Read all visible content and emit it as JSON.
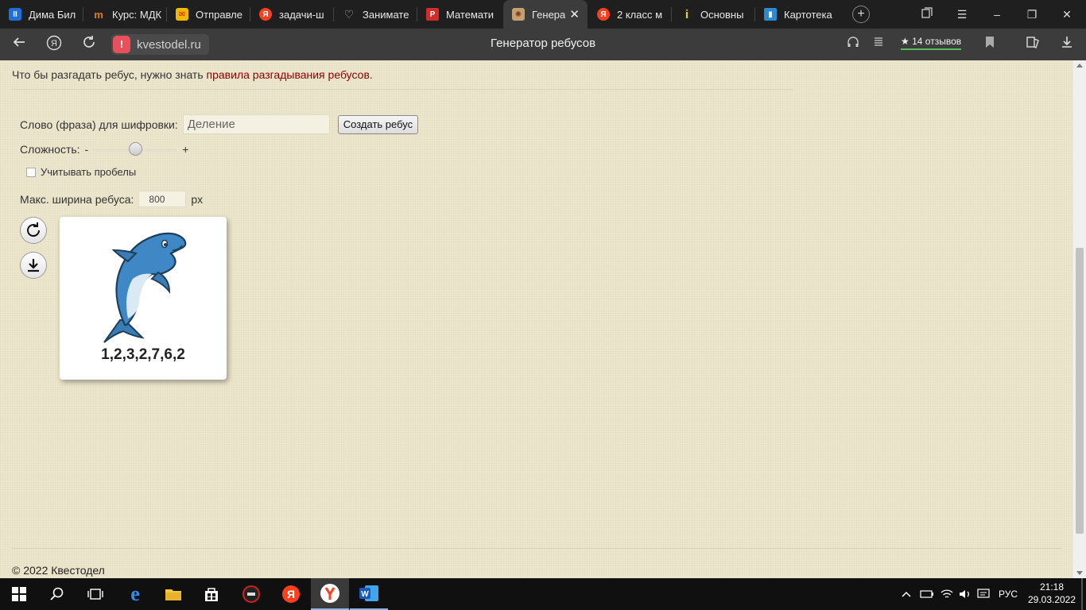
{
  "browser": {
    "tabs": [
      {
        "title": "Дима Бил",
        "icon": "app-blue-icon",
        "color": "#1e6fd9",
        "glyph": "II"
      },
      {
        "title": "Курс: МДК",
        "icon": "m-logo-icon",
        "color": "#e07a1f",
        "glyph": "m"
      },
      {
        "title": "Отправле",
        "icon": "mail-icon",
        "color": "#f5b800",
        "glyph": "✉"
      },
      {
        "title": "задачи-ш",
        "icon": "yandex-icon",
        "color": "#fc3f1d",
        "glyph": "Я"
      },
      {
        "title": "Занимате",
        "icon": "heart-icon",
        "color": "#555555",
        "glyph": "♡"
      },
      {
        "title": "Математи",
        "icon": "p-logo-icon",
        "color": "#d22b2b",
        "glyph": "P"
      },
      {
        "title": "Генера",
        "icon": "rebus-site-icon",
        "color": "#c8a070",
        "glyph": "✺",
        "active": true
      },
      {
        "title": "2 класс м",
        "icon": "yandex-icon",
        "color": "#fc3f1d",
        "glyph": "Я"
      },
      {
        "title": "Основны",
        "icon": "info-icon",
        "color": "#f3d11f",
        "glyph": "i"
      },
      {
        "title": "Картотека",
        "icon": "book-icon",
        "color": "#2a8ad2",
        "glyph": "▮"
      }
    ],
    "url_host": "kvestodel.ru",
    "page_title": "Генератор ребусов",
    "reviews_label": "14 отзывов"
  },
  "page": {
    "intro_text": "Что бы разгадать ребус, нужно знать ",
    "intro_link": "правила разгадывания ребусов",
    "intro_end": ".",
    "word_label": "Слово (фраза) для шифровки:",
    "word_value": "Деление",
    "create_button": "Создать ребус",
    "difficulty_label": "Сложность:",
    "difficulty_minus": "-",
    "difficulty_plus": "+",
    "difficulty_level": 0.5,
    "spaces_label": "Учитывать пробелы",
    "spaces_checked": false,
    "width_label": "Макс. ширина ребуса:",
    "width_value": "800",
    "width_unit": "px",
    "rebus_code": "1,2,3,2,7,6,2",
    "footer": "© 2022 Квестодел"
  },
  "taskbar": {
    "language": "РУС",
    "time": "21:18",
    "date": "29.03.2022"
  },
  "colors": {
    "page_bg": "#ece6cc",
    "link": "#8b0000",
    "browser_chrome": "#3c3c3c",
    "warning_badge": "#e8505b"
  }
}
